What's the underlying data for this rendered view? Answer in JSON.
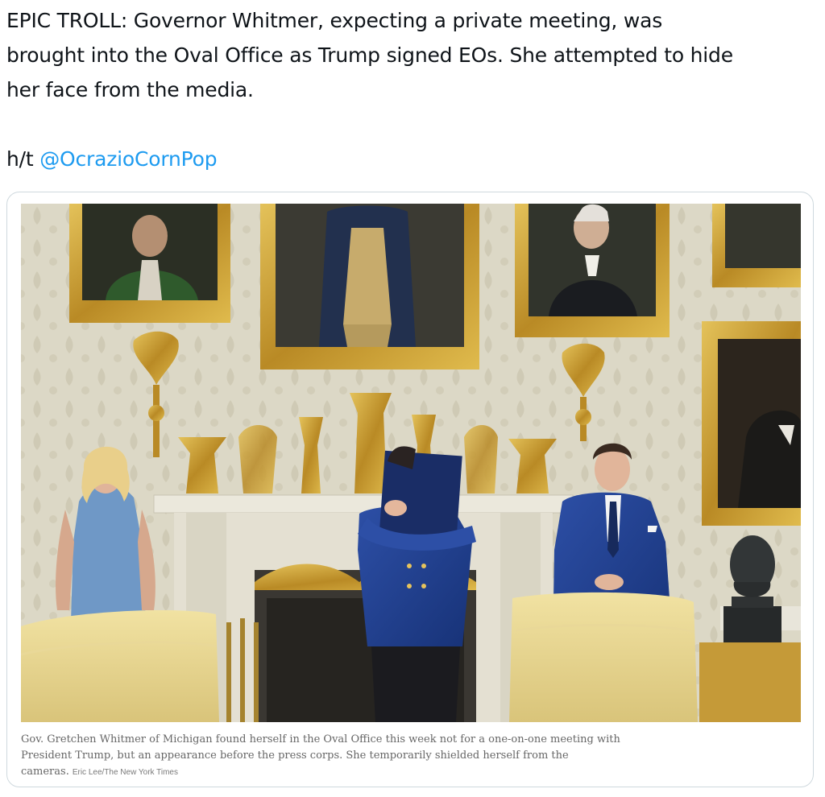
{
  "tweet": {
    "text_lines": [
      "EPIC TROLL: Governor Whitmer, expecting a private meeting, was",
      "brought into the Oval Office as Trump signed EOs. She attempted to hide",
      "her face from the media."
    ],
    "ht_prefix": "h/t ",
    "mention": "@OcrazioCornPop"
  },
  "media": {
    "photo_alt_icon": "oval-office-photo",
    "caption": "Gov. Gretchen Whitmer of Michigan found herself in the Oval Office this week not for a one-on-one meeting with President Trump, but an appearance before the press corps. She temporarily shielded herself from the cameras.",
    "credit": "Eric Lee/The New York Times"
  },
  "colors": {
    "text": "#0f1419",
    "link": "#1d9bf0",
    "card_border": "#cfd9de",
    "caption": "#666666"
  }
}
